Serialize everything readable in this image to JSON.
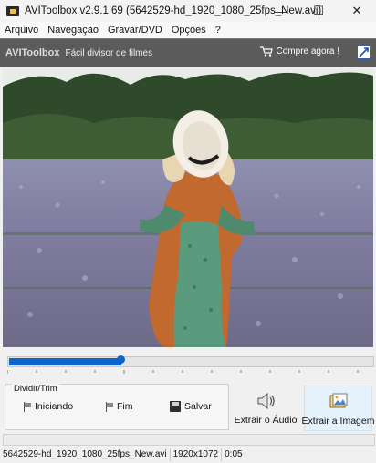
{
  "window": {
    "title": "AVIToolbox v2.9.1.69 (5642529-hd_1920_1080_25fps_New.avi)",
    "minimize": "—",
    "maximize": "☐",
    "close": "✕"
  },
  "menu": [
    "Arquivo",
    "Navegação",
    "Gravar/DVD",
    "Opções",
    "?"
  ],
  "toolbar": {
    "brand": "AVIToolbox",
    "tagline": "Fácil divisor de filmes",
    "buy": "Compre agora !"
  },
  "video": {
    "scene": "woman in straw hat in a meadow of purple flowers"
  },
  "seek": {
    "position_fraction": 0.31
  },
  "trim": {
    "legend": "Dividir/Trim",
    "start": "Iniciando",
    "end": "Fim",
    "save": "Salvar"
  },
  "actions": {
    "extract_audio": "Extrair o Áudio",
    "extract_image": "Extrair a Imagem"
  },
  "status": {
    "filename": "5642529-hd_1920_1080_25fps_New.avi",
    "resolution": "1920x1072",
    "time": "0:05"
  },
  "icons": [
    "app-icon",
    "cart-icon",
    "help-icon",
    "flag-icon",
    "floppy-icon",
    "speaker-icon",
    "image-icon"
  ]
}
